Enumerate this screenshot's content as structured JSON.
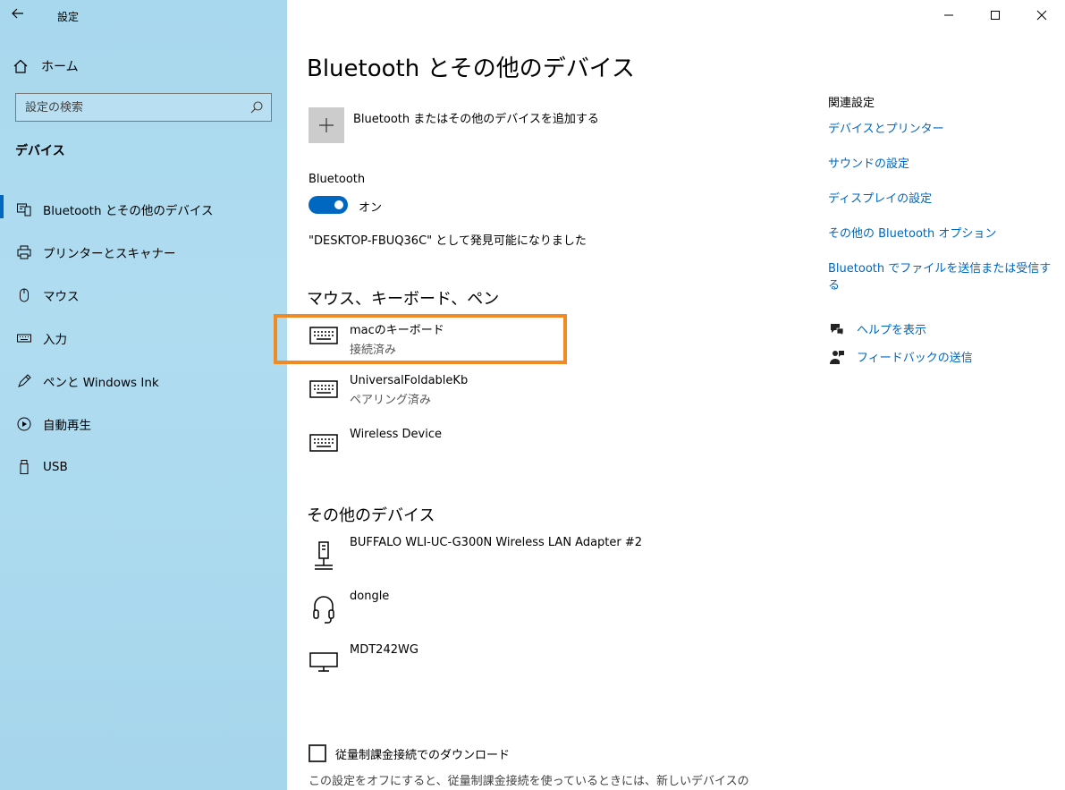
{
  "app": {
    "title": "設定"
  },
  "sidebar": {
    "home_label": "ホーム",
    "search_placeholder": "設定の検索",
    "section": "デバイス",
    "items": [
      {
        "label": "Bluetooth とその他のデバイス",
        "icon": "bluetooth-device-icon",
        "active": true
      },
      {
        "label": "プリンターとスキャナー",
        "icon": "printer-icon"
      },
      {
        "label": "マウス",
        "icon": "mouse-icon"
      },
      {
        "label": "入力",
        "icon": "keyboard-icon"
      },
      {
        "label": "ペンと Windows Ink",
        "icon": "pen-icon"
      },
      {
        "label": "自動再生",
        "icon": "autoplay-icon"
      },
      {
        "label": "USB",
        "icon": "usb-icon"
      }
    ]
  },
  "main": {
    "title": "Bluetooth とその他のデバイス",
    "add_label": "Bluetooth またはその他のデバイスを追加する",
    "bluetooth_label": "Bluetooth",
    "toggle_state": "オン",
    "discoverable": "\"DESKTOP-FBUQ36C\" として発見可能になりました",
    "input_section": "マウス、キーボード、ペン",
    "input_devices": [
      {
        "name": "macのキーボード",
        "status": "接続済み"
      },
      {
        "name": "UniversalFoldableKb",
        "status": "ペアリング済み"
      },
      {
        "name": "Wireless Device",
        "status": ""
      }
    ],
    "other_section": "その他のデバイス",
    "other_devices": [
      {
        "name": "BUFFALO WLI-UC-G300N Wireless LAN Adapter #2",
        "icon": "network-adapter-icon"
      },
      {
        "name": "dongle",
        "icon": "headset-icon"
      },
      {
        "name": "MDT242WG",
        "icon": "monitor-icon"
      }
    ],
    "metered_label": "従量制課金接続でのダウンロード",
    "metered_desc": "この設定をオフにすると、従量制課金接続を使っているときには、新しいデバイスの"
  },
  "related": {
    "heading": "関連設定",
    "links": [
      "デバイスとプリンター",
      "サウンドの設定",
      "ディスプレイの設定",
      "その他の Bluetooth オプション",
      "Bluetooth でファイルを送信または受信する"
    ],
    "help": "ヘルプを表示",
    "feedback": "フィードバックの送信"
  },
  "colors": {
    "accent": "#0067c0",
    "highlight": "#f08a24",
    "sidebar": "#a8d8ee"
  }
}
